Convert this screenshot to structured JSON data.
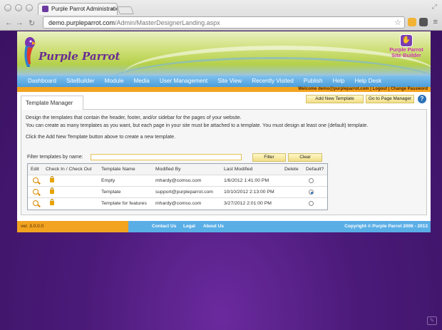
{
  "browser": {
    "tab_title": "Purple Parrot Administratio",
    "tab_close": "×",
    "url_host": "demo.purpleparrot.com",
    "url_path": "/Admin/MasterDesignerLanding.aspx",
    "back": "←",
    "forward": "→",
    "reload": "↻",
    "star": "☆",
    "menu": "≡"
  },
  "header": {
    "logo_text": "Purple Parrot",
    "badge_line1": "Purple Parrot",
    "badge_line2": "Site Builder"
  },
  "nav": {
    "items": [
      "Dashboard",
      "SiteBuilder",
      "Module",
      "Media",
      "User Management",
      "Site View",
      "Recently Visited",
      "Publish",
      "Help",
      "Help Desk"
    ]
  },
  "userbar": {
    "text": "Welcome demo@purpleparrot.com | Logout | Change Password"
  },
  "panel": {
    "tab_label": "Template Manager",
    "add_new_button": "Add New Template",
    "go_to_page_manager_button": "Go to Page Manager",
    "help": "?",
    "desc1": "Design the templates that contain the header, footer, and/or sidebar for the pages of your website.",
    "desc2": "You can create as many templates as you want, but each page in your site must be attached to a template. You must design at least one (default) template.",
    "desc3": "Click the Add New Template button above to create a new template.",
    "filter_label": "Filter templates by name:",
    "filter_value": "",
    "filter_button": "Filter",
    "clear_button": "Clear"
  },
  "table": {
    "headers": {
      "edit": "Edit",
      "checkinout": "Check In / Check Out",
      "name": "Template Name",
      "modified_by": "Modified By",
      "last_modified": "Last Modified",
      "delete": "Delete",
      "default": "Default?"
    },
    "rows": [
      {
        "name": "Empty",
        "modified_by": "mhardy@comso.com",
        "last_modified": "1/6/2012 1:41:00 PM",
        "default": false
      },
      {
        "name": "Template",
        "modified_by": "support@purpleparrot.com",
        "last_modified": "10/10/2012 2:13:00 PM",
        "default": true
      },
      {
        "name": "Template for features",
        "modified_by": "mhardy@comso.com",
        "last_modified": "3/27/2012 2:01:00 PM",
        "default": false
      }
    ]
  },
  "footer": {
    "version": "ver. 3.0.0.0",
    "contact": "Contact Us",
    "legal": "Legal",
    "about": "About Us",
    "copyright": "Copyright © Purple Parrot 2006 - 2013"
  },
  "colors": {
    "nav_blue": "#5aaee6",
    "accent_orange": "#f2a320",
    "brand_purple": "#6a2c92",
    "page_bg": "#4a1a78"
  }
}
